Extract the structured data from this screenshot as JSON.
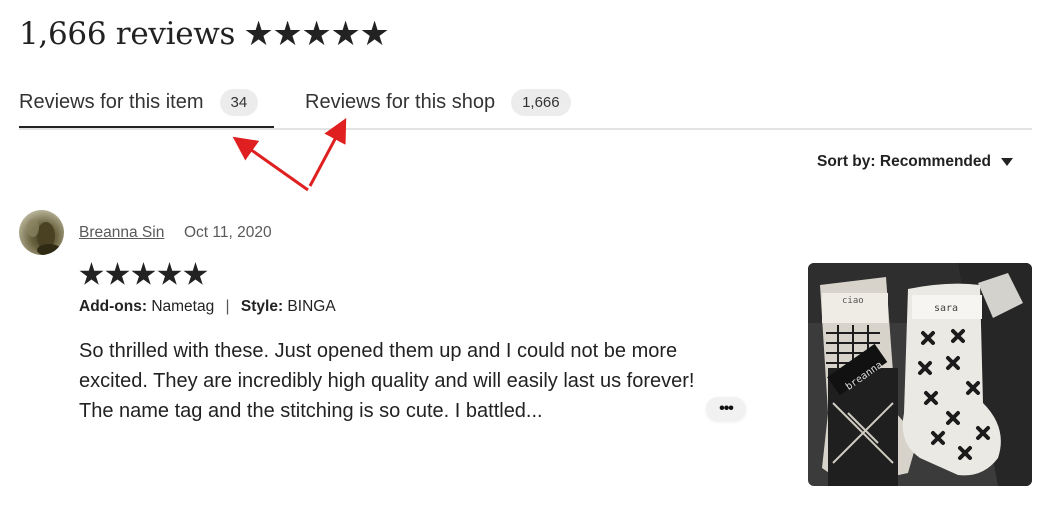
{
  "header": {
    "title": "1,666 reviews",
    "rating_stars": 5,
    "stars_icon": "star-icon"
  },
  "tabs": [
    {
      "label": "Reviews for this item",
      "count": "34",
      "active": true
    },
    {
      "label": "Reviews for this shop",
      "count": "1,666",
      "active": false
    }
  ],
  "sort": {
    "prefix": "Sort by:",
    "value": "Recommended"
  },
  "review": {
    "reviewer": "Breanna Sin",
    "date": "Oct 11, 2020",
    "rating_stars": 5,
    "addons_label": "Add-ons:",
    "addons_value": "Nametag",
    "style_label": "Style:",
    "style_value": "BINGA",
    "text": "So thrilled with these. Just opened them up and I could not be more excited. They are incredibly high quality and will easily last us forever! The name tag and the stitching is so cute. I battled...",
    "more_label": "•••",
    "photo_tags": [
      "ciao",
      "sara",
      "breanna"
    ]
  },
  "colors": {
    "text": "#222222",
    "muted": "#595959",
    "pill": "#ececec",
    "divider": "#e3e3e3",
    "arrow": "#e02020"
  }
}
